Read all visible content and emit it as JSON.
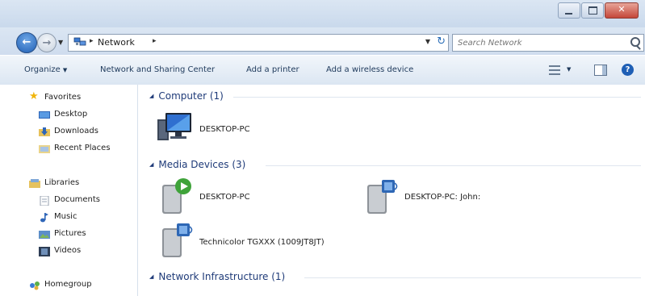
{
  "window": {
    "title": "Network"
  },
  "address_bar": {
    "path": "Network",
    "search_placeholder": "Search Network"
  },
  "toolbar": {
    "organize_label": "Organize",
    "network_sharing_label": "Network and Sharing Center",
    "add_printer_label": "Add a printer",
    "add_wireless_label": "Add a wireless device"
  },
  "sidebar": {
    "favorites_header": "Favorites",
    "favorites": [
      {
        "label": "Desktop",
        "icon": "desktop-icon"
      },
      {
        "label": "Downloads",
        "icon": "downloads-icon"
      },
      {
        "label": "Recent Places",
        "icon": "recent-places-icon"
      }
    ],
    "libraries_header": "Libraries",
    "libraries": [
      {
        "label": "Documents",
        "icon": "documents-icon"
      },
      {
        "label": "Music",
        "icon": "music-icon"
      },
      {
        "label": "Pictures",
        "icon": "pictures-icon"
      },
      {
        "label": "Videos",
        "icon": "videos-icon"
      }
    ],
    "homegroup_label": "Homegroup"
  },
  "groups": {
    "computer": {
      "header": "Computer (1)",
      "items": [
        {
          "label": "DESKTOP-PC",
          "icon": "computer-icon"
        }
      ]
    },
    "media": {
      "header": "Media Devices (3)",
      "items": [
        {
          "label": "DESKTOP-PC",
          "icon": "media-player-icon"
        },
        {
          "label": "DESKTOP-PC: John:",
          "icon": "media-server-icon"
        },
        {
          "label": "Technicolor TGXXX (1009JT8JT)",
          "icon": "media-server-icon"
        }
      ]
    },
    "infrastructure": {
      "header": "Network Infrastructure (1)"
    }
  },
  "colors": {
    "chrome_gradient_top": "#dbe6f3",
    "command_bar_text": "#1e395b",
    "group_header_text": "#1e3a78",
    "close_button": "#c4473a"
  }
}
